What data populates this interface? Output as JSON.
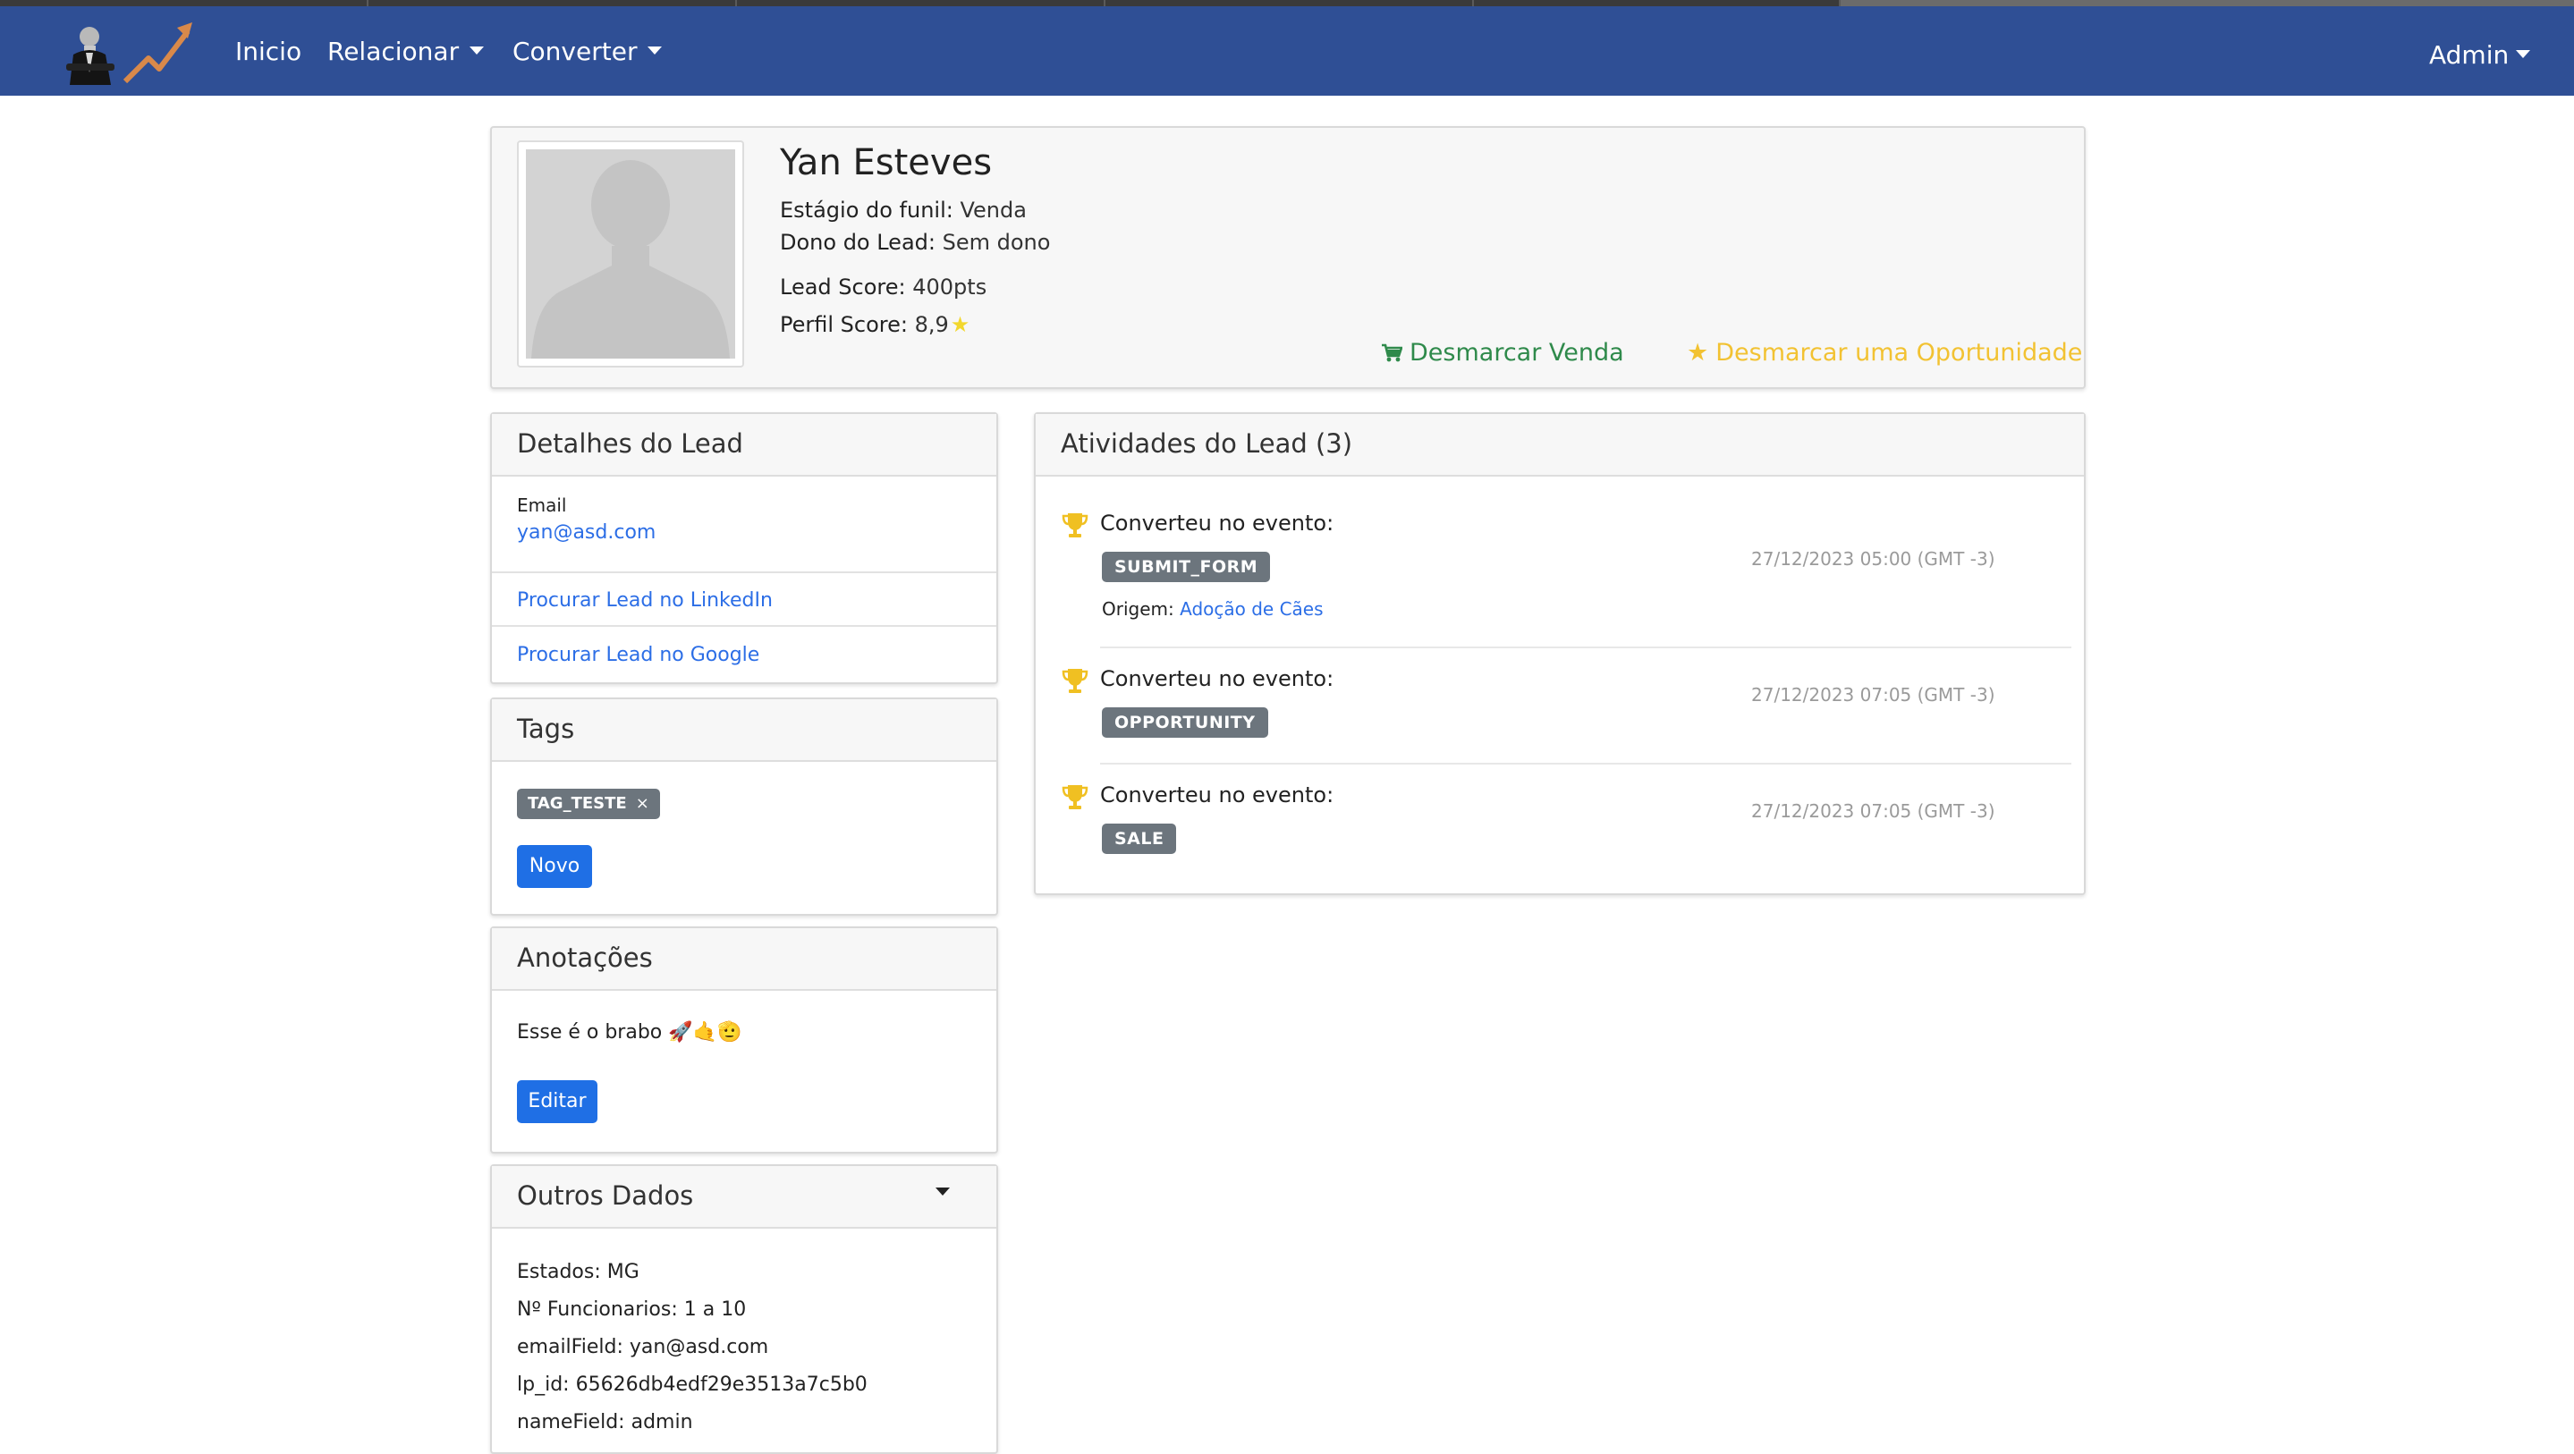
{
  "nav": {
    "items": [
      {
        "label": "Inicio",
        "dropdown": false
      },
      {
        "label": "Relacionar",
        "dropdown": true
      },
      {
        "label": "Converter",
        "dropdown": true
      }
    ],
    "user": "Admin",
    "bar_color": "#2f4f95"
  },
  "lead": {
    "name": "Yan Esteves",
    "stage_label": "Estágio do funil:",
    "stage_value": "Venda",
    "owner_label": "Dono do Lead:",
    "owner_value": "Sem dono",
    "score_label": "Lead Score:",
    "score_value": "400pts",
    "profile_label": "Perfil Score:",
    "profile_value": "8,9",
    "actions": {
      "unmark_sale": "Desmarcar Venda",
      "unmark_opportunity": "Desmarcar uma Oportunidade"
    }
  },
  "details": {
    "title": "Detalhes do Lead",
    "email_label": "Email",
    "email_value": "yan@asd.com",
    "linkedin_link": "Procurar Lead no LinkedIn",
    "google_link": "Procurar Lead no Google"
  },
  "tags": {
    "title": "Tags",
    "items": [
      "TAG_TESTE"
    ],
    "remove_glyph": "×",
    "new_button": "Novo"
  },
  "notes": {
    "title": "Anotações",
    "text": "Esse é o brabo 🚀🤙🫡",
    "edit_button": "Editar"
  },
  "other": {
    "title": "Outros Dados",
    "fields": [
      {
        "key": "Estados:",
        "value": "MG"
      },
      {
        "key": "Nº Funcionarios:",
        "value": "1 a 10"
      },
      {
        "key": "emailField:",
        "value": "yan@asd.com"
      },
      {
        "key": "lp_id:",
        "value": "65626db4edf29e3513a7c5b0"
      },
      {
        "key": "nameField:",
        "value": "admin"
      }
    ]
  },
  "activities": {
    "title": "Atividades do Lead (3)",
    "items": [
      {
        "text": "Converteu no evento:",
        "event": "SUBMIT_FORM",
        "time": "27/12/2023 05:00 (GMT -3)",
        "origin_label": "Origem:",
        "origin_value": "Adoção de Cães"
      },
      {
        "text": "Converteu no evento:",
        "event": "OPPORTUNITY",
        "time": "27/12/2023 07:05 (GMT -3)"
      },
      {
        "text": "Converteu no evento:",
        "event": "SALE",
        "time": "27/12/2023 07:05 (GMT -3)"
      }
    ]
  },
  "colors": {
    "link": "#2c6ee6",
    "sale_green": "#2f8a4b",
    "opportunity_yellow": "#f2c232",
    "badge_gray": "#6c757d",
    "primary_button": "#1f6fe5"
  }
}
